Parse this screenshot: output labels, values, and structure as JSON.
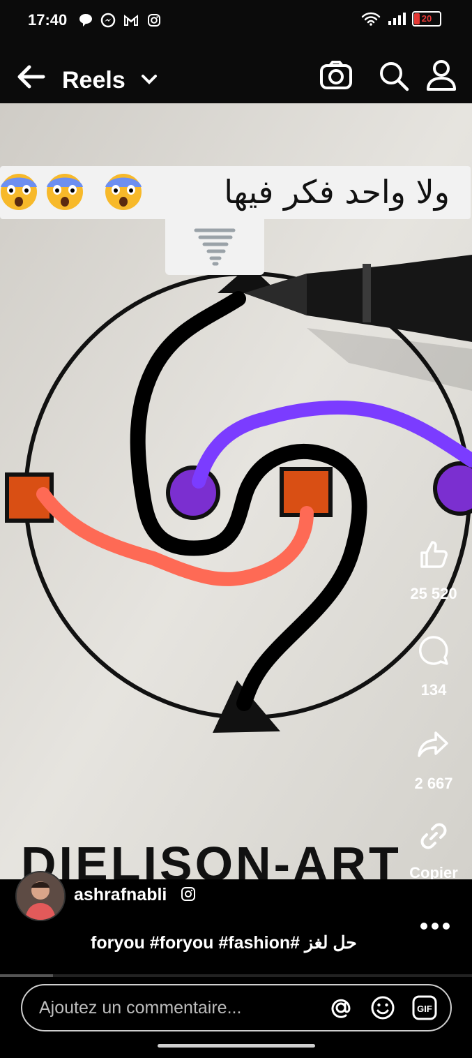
{
  "status": {
    "time": "17:40",
    "battery": "20"
  },
  "header": {
    "title": "Reels"
  },
  "video": {
    "caption": "ولا واحد فكر فيها",
    "watermark": "DIELISON-ART"
  },
  "actions": {
    "likes": "25 520",
    "comments": "134",
    "shares": "2 667",
    "copy_label": "Copier"
  },
  "post": {
    "username": "ashrafnabli",
    "description": "foryou #foryou #fashion# حل لغز"
  },
  "comment": {
    "placeholder": "Ajoutez un commentaire..."
  }
}
